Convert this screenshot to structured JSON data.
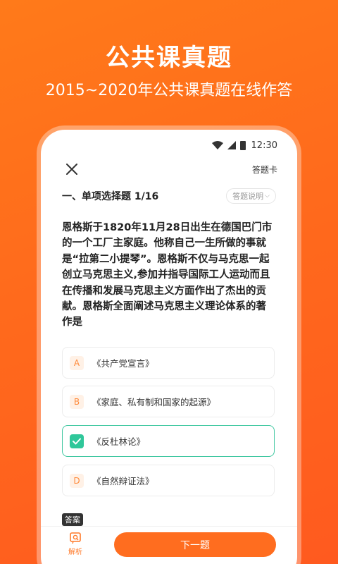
{
  "promo": {
    "title": "公共课真题",
    "subtitle": "2015~2020年公共课真题在线作答"
  },
  "status_bar": {
    "time": "12:30"
  },
  "header": {
    "answer_card": "答题卡"
  },
  "section": {
    "title": "一、单项选择题 1/16",
    "explain_label": "答题说明"
  },
  "question": {
    "text": "恩格斯于1820年11月28日出生在德国巴门市的一个工厂主家庭。他称自己一生所做的事就是“拉第二小提琴”。恩格斯不仅与马克思一起创立马克思主义,参加并指导国际工人运动而且在传播和发展马克思主义方面作出了杰出的贡献。恩格斯全面阐述马克思主义理论体系的著作是"
  },
  "options": [
    {
      "letter": "A",
      "text": "《共产党宣言》",
      "selected": false
    },
    {
      "letter": "B",
      "text": "《家庭、私有制和国家的起源》",
      "selected": false
    },
    {
      "letter": "C",
      "text": "《反杜林论》",
      "selected": true
    },
    {
      "letter": "D",
      "text": "《自然辩证法》",
      "selected": false
    }
  ],
  "answer_tag": "答案",
  "bottom": {
    "analysis_label": "解析",
    "next_label": "下一题"
  },
  "colors": {
    "brand": "#ff6d1f",
    "selected": "#2fc79a"
  }
}
